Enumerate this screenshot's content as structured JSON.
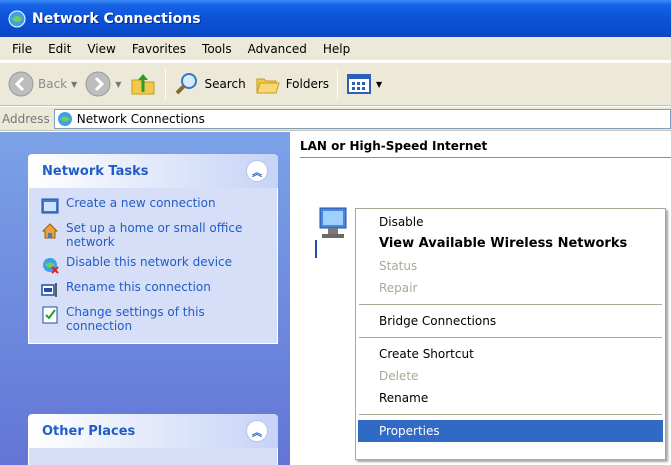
{
  "window": {
    "title": "Network Connections"
  },
  "menubar": {
    "items": [
      "File",
      "Edit",
      "View",
      "Favorites",
      "Tools",
      "Advanced",
      "Help"
    ]
  },
  "toolbar": {
    "back_label": "Back",
    "search_label": "Search",
    "folders_label": "Folders"
  },
  "address": {
    "label": "Address",
    "value": "Network Connections"
  },
  "network_tasks": {
    "title": "Network Tasks",
    "items": [
      {
        "label": "Create a new connection"
      },
      {
        "label": "Set up a home or small office network"
      },
      {
        "label": "Disable this network device"
      },
      {
        "label": "Rename this connection"
      },
      {
        "label": "Change settings of this connection"
      }
    ]
  },
  "other_places": {
    "title": "Other Places"
  },
  "content": {
    "group_header": "LAN or High-Speed Internet"
  },
  "context_menu": {
    "items": [
      {
        "label": "Disable"
      },
      {
        "label": "View Available Wireless Networks"
      },
      {
        "label": "Status"
      },
      {
        "label": "Repair"
      },
      {
        "label": "Bridge Connections"
      },
      {
        "label": "Create Shortcut"
      },
      {
        "label": "Delete"
      },
      {
        "label": "Rename"
      },
      {
        "label": "Properties"
      }
    ]
  },
  "colors": {
    "title_bar": "#0c52d8",
    "task_link": "#215dc6",
    "selection": "#316ac5",
    "left_pane": "#7ba2e7"
  }
}
